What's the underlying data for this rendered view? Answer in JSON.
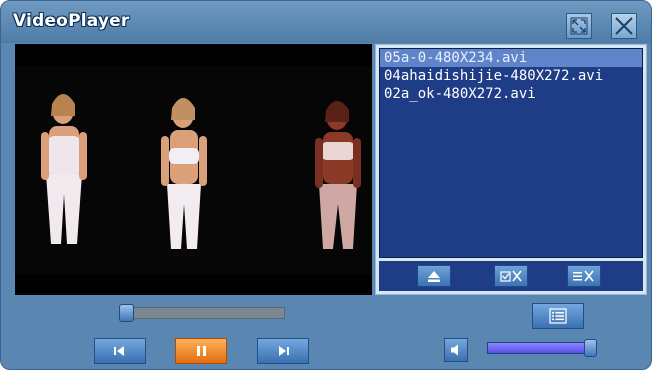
{
  "window": {
    "title": "VideoPlayer"
  },
  "titlebar": {
    "fullscreen_icon": "fullscreen-icon",
    "close_icon": "close-icon"
  },
  "playlist": {
    "items": [
      {
        "label": "05a-0-480X234.avi",
        "selected": true
      },
      {
        "label": "04ahaidishijie-480X272.avi",
        "selected": false
      },
      {
        "label": "02a_ok-480X272.avi",
        "selected": false
      }
    ],
    "toolbar": {
      "eject_icon": "eject-icon",
      "check_remove_icon": "check-remove-icon",
      "list_remove_icon": "list-remove-icon"
    }
  },
  "playback": {
    "seek_position": 0.0,
    "volume_level": 0.95,
    "state": "playing"
  },
  "colors": {
    "window_bg": "#5a87b1",
    "playlist_bg": "#1f3c86",
    "selected_item": "#5f85c8",
    "pause_accent": "#f08a24"
  }
}
